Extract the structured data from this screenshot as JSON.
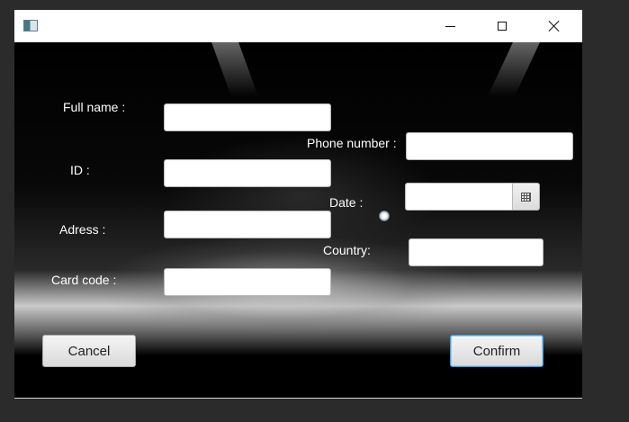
{
  "window": {
    "icon": "app-window-icon",
    "controls": [
      "minimize-icon",
      "maximize-icon",
      "close-icon"
    ]
  },
  "form": {
    "full_name_label": "Full name :",
    "id_label": "ID :",
    "address_label": "Adress :",
    "card_code_label": "Card code :",
    "phone_label": "Phone number :",
    "date_label": "Date :",
    "country_label": "Country:",
    "full_name_value": "",
    "id_value": "",
    "address_value": "",
    "card_code_value": "",
    "phone_value": "",
    "date_value": "",
    "country_value": ""
  },
  "buttons": {
    "cancel_label": "Cancel",
    "confirm_label": "Confirm"
  },
  "colors": {
    "background": "#000000",
    "confirm_focus": "#3f9ad6"
  }
}
